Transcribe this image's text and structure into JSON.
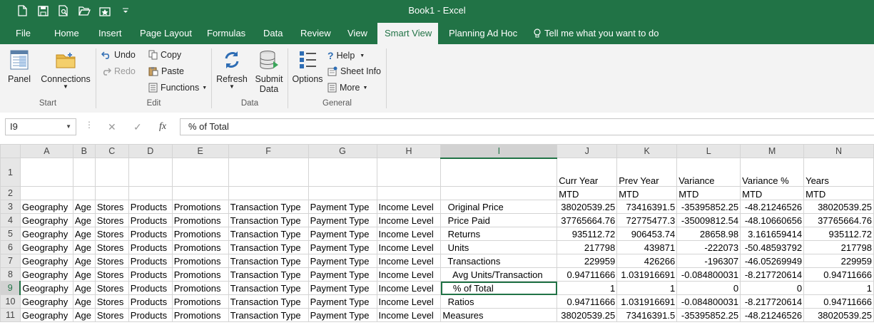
{
  "window": {
    "title": "Book1  -  Excel"
  },
  "quick_access": {
    "new_icon": "new-document-icon",
    "save_icon": "save-icon",
    "preview_icon": "print-preview-icon",
    "open_icon": "open-folder-icon",
    "smart_icon": "smartview-icon",
    "customize_icon": "customize-caret-icon"
  },
  "tabs": [
    "File",
    "Home",
    "Insert",
    "Page Layout",
    "Formulas",
    "Data",
    "Review",
    "View",
    "Smart View",
    "Planning Ad Hoc"
  ],
  "tell_me": "Tell me what you want to do",
  "ribbon": {
    "start": {
      "panel": "Panel",
      "connections": "Connections",
      "group": "Start"
    },
    "edit": {
      "undo": "Undo",
      "redo": "Redo",
      "copy": "Copy",
      "paste": "Paste",
      "functions": "Functions",
      "group": "Edit"
    },
    "data": {
      "refresh": "Refresh",
      "submit_line1": "Submit",
      "submit_line2": "Data",
      "group": "Data"
    },
    "general": {
      "options": "Options",
      "help": "Help",
      "sheet_info": "Sheet Info",
      "more": "More",
      "group": "General"
    }
  },
  "formula_bar": {
    "name_box": "I9",
    "formula": "% of Total",
    "fx": "fx"
  },
  "sheet": {
    "columns": [
      "A",
      "B",
      "C",
      "D",
      "E",
      "F",
      "G",
      "H",
      "I",
      "J",
      "K",
      "L",
      "M",
      "N"
    ],
    "rows": [
      {
        "num": "1",
        "cells": [
          "",
          "",
          "",
          "",
          "",
          "",
          "",
          "",
          "",
          "Curr Year",
          "Prev Year",
          "Variance",
          "Variance %",
          "Years"
        ]
      },
      {
        "num": "2",
        "cells": [
          "",
          "",
          "",
          "",
          "",
          "",
          "",
          "",
          "",
          "MTD",
          "MTD",
          "MTD",
          "MTD",
          "MTD"
        ]
      },
      {
        "num": "3",
        "cells": [
          "Geography",
          "Age",
          "Stores",
          "Products",
          "Promotions",
          "Transaction Type",
          "Payment Type",
          "Income Level",
          "  Original Price",
          "38020539.25",
          "73416391.5",
          "-35395852.25",
          "-48.21246526",
          "38020539.25"
        ]
      },
      {
        "num": "4",
        "cells": [
          "Geography",
          "Age",
          "Stores",
          "Products",
          "Promotions",
          "Transaction Type",
          "Payment Type",
          "Income Level",
          "  Price Paid",
          "37765664.76",
          "72775477.3",
          "-35009812.54",
          "-48.10660656",
          "37765664.76"
        ]
      },
      {
        "num": "5",
        "cells": [
          "Geography",
          "Age",
          "Stores",
          "Products",
          "Promotions",
          "Transaction Type",
          "Payment Type",
          "Income Level",
          "  Returns",
          "935112.72",
          "906453.74",
          "28658.98",
          "3.161659414",
          "935112.72"
        ]
      },
      {
        "num": "6",
        "cells": [
          "Geography",
          "Age",
          "Stores",
          "Products",
          "Promotions",
          "Transaction Type",
          "Payment Type",
          "Income Level",
          "  Units",
          "217798",
          "439871",
          "-222073",
          "-50.48593792",
          "217798"
        ]
      },
      {
        "num": "7",
        "cells": [
          "Geography",
          "Age",
          "Stores",
          "Products",
          "Promotions",
          "Transaction Type",
          "Payment Type",
          "Income Level",
          "  Transactions",
          "229959",
          "426266",
          "-196307",
          "-46.05269949",
          "229959"
        ]
      },
      {
        "num": "8",
        "cells": [
          "Geography",
          "Age",
          "Stores",
          "Products",
          "Promotions",
          "Transaction Type",
          "Payment Type",
          "Income Level",
          "    Avg Units/Transaction",
          "0.94711666",
          "1.031916691",
          "-0.084800031",
          "-8.217720614",
          "0.94711666"
        ]
      },
      {
        "num": "9",
        "cells": [
          "Geography",
          "Age",
          "Stores",
          "Products",
          "Promotions",
          "Transaction Type",
          "Payment Type",
          "Income Level",
          "    % of Total",
          "1",
          "1",
          "0",
          "0",
          "1"
        ]
      },
      {
        "num": "10",
        "cells": [
          "Geography",
          "Age",
          "Stores",
          "Products",
          "Promotions",
          "Transaction Type",
          "Payment Type",
          "Income Level",
          "  Ratios",
          "0.94711666",
          "1.031916691",
          "-0.084800031",
          "-8.217720614",
          "0.94711666"
        ]
      },
      {
        "num": "11",
        "cells": [
          "Geography",
          "Age",
          "Stores",
          "Products",
          "Promotions",
          "Transaction Type",
          "Payment Type",
          "Income Level",
          "Measures",
          "38020539.25",
          "73416391.5",
          "-35395852.25",
          "-48.21246526",
          "38020539.25"
        ]
      }
    ],
    "selected_cell": "I9"
  },
  "colors": {
    "accent": "#217346",
    "ribbon_bg": "#f3f3f3",
    "header_bg": "#e6e6e6",
    "grid_line": "#d4d4d4"
  }
}
